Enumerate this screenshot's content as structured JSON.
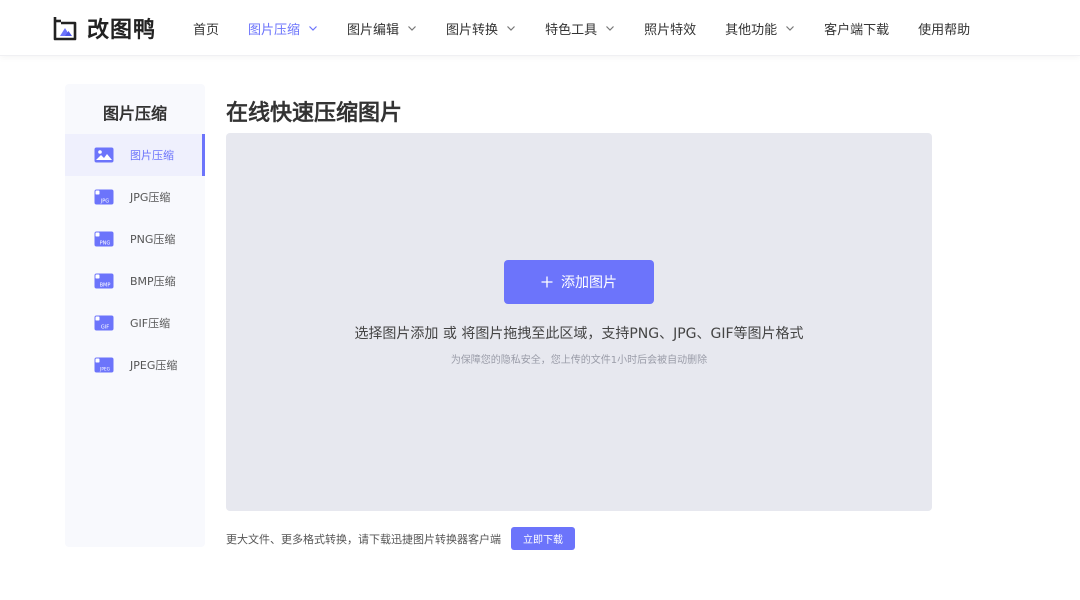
{
  "brand": {
    "name": "改图鸭",
    "logo_icon": "duck-frame-logo-icon",
    "accent": "#6c74fb"
  },
  "nav": {
    "items": [
      {
        "label": "首页",
        "dropdown": false,
        "active": false
      },
      {
        "label": "图片压缩",
        "dropdown": true,
        "active": true
      },
      {
        "label": "图片编辑",
        "dropdown": true,
        "active": false
      },
      {
        "label": "图片转换",
        "dropdown": true,
        "active": false
      },
      {
        "label": "特色工具",
        "dropdown": true,
        "active": false
      },
      {
        "label": "照片特效",
        "dropdown": false,
        "active": false
      },
      {
        "label": "其他功能",
        "dropdown": true,
        "active": false
      },
      {
        "label": "客户端下载",
        "dropdown": false,
        "active": false
      },
      {
        "label": "使用帮助",
        "dropdown": false,
        "active": false
      }
    ]
  },
  "sidebar": {
    "title": "图片压缩",
    "items": [
      {
        "label": "图片压缩",
        "icon": "image-file-icon",
        "active": true
      },
      {
        "label": "JPG压缩",
        "icon": "jpg-file-icon",
        "badge": "JPG",
        "active": false
      },
      {
        "label": "PNG压缩",
        "icon": "png-file-icon",
        "badge": "PNG",
        "active": false
      },
      {
        "label": "BMP压缩",
        "icon": "bmp-file-icon",
        "badge": "BMP",
        "active": false
      },
      {
        "label": "GIF压缩",
        "icon": "gif-file-icon",
        "badge": "GIF",
        "active": false
      },
      {
        "label": "JPEG压缩",
        "icon": "jpeg-file-icon",
        "badge": "JPEG",
        "active": false
      }
    ]
  },
  "main": {
    "title": "在线快速压缩图片",
    "add_button": "添加图片",
    "hint": "选择图片添加 或 将图片拖拽至此区域，支持PNG、JPG、GIF等图片格式",
    "privacy": "为保障您的隐私安全，您上传的文件1小时后会被自动删除"
  },
  "footer": {
    "note": "更大文件、更多格式转换，请下载迅捷图片转换器客户端",
    "download_button": "立即下载"
  }
}
